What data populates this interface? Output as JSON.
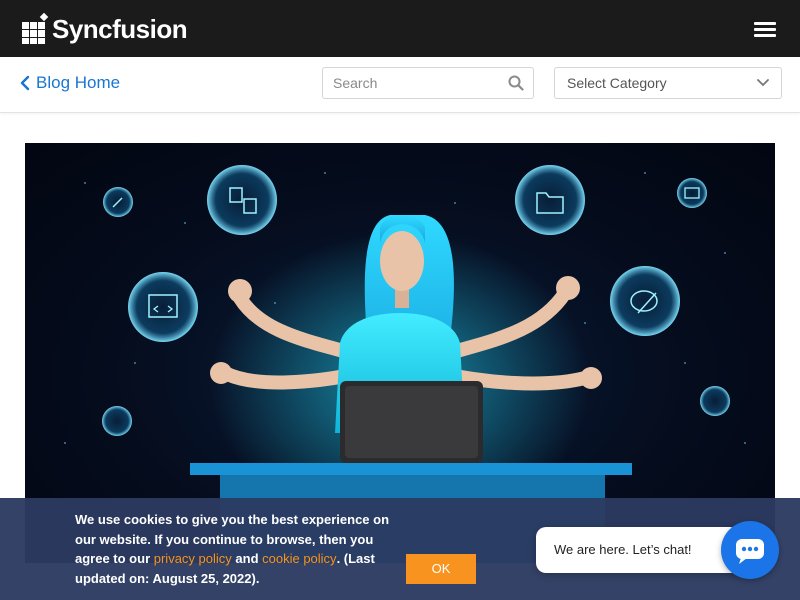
{
  "header": {
    "brand": "Syncfusion",
    "menu_icon": "hamburger-menu-icon"
  },
  "subnav": {
    "blog_home": "Blog Home",
    "search_placeholder": "Search",
    "category_label": "Select Category"
  },
  "hero": {
    "description_icons": [
      "flowchart-icon",
      "folder-icon",
      "code-window-icon",
      "palette-icon",
      "pen-icon",
      "browser-icon"
    ]
  },
  "cookie": {
    "text_before": "We use cookies to give you the best experience on our website. If you continue to browse, then you agree to our ",
    "privacy_link": "privacy policy",
    "and": " and ",
    "cookie_link": "cookie policy",
    "text_after": ". (Last updated on: August 25, 2022).",
    "ok_label": "OK"
  },
  "chat": {
    "bubble_text": "We are here. Let’s chat!"
  },
  "colors": {
    "topbar": "#1b1b1b",
    "link_blue": "#1976d2",
    "cookie_bg": "#2c3a61",
    "accent_orange": "#f7931e",
    "chat_blue": "#1b74e8"
  }
}
